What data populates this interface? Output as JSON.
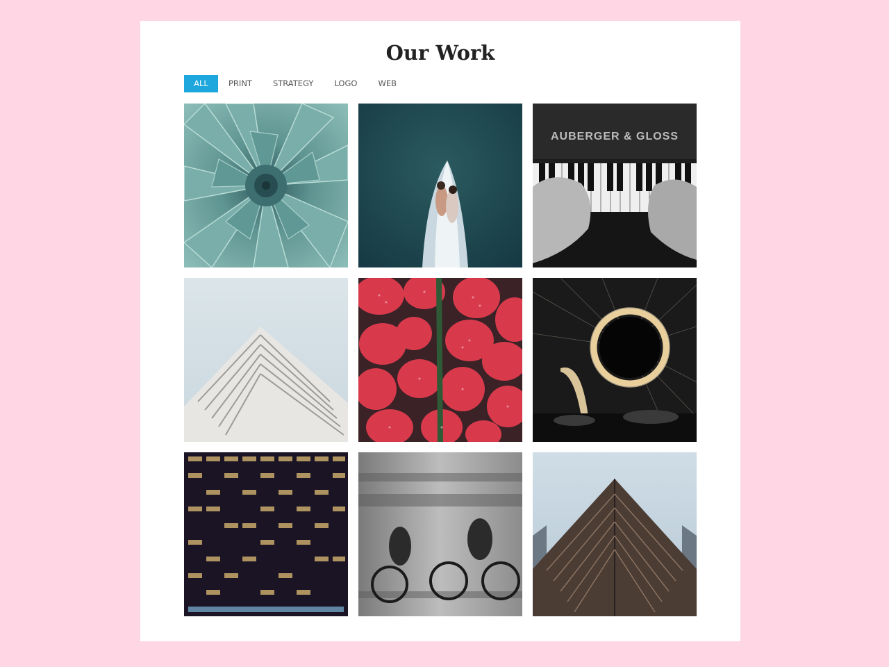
{
  "header": {
    "title": "Our Work"
  },
  "filters": [
    {
      "label": "All",
      "active": true
    },
    {
      "label": "Print",
      "active": false
    },
    {
      "label": "Strategy",
      "active": false
    },
    {
      "label": "Logo",
      "active": false
    },
    {
      "label": "Web",
      "active": false
    }
  ],
  "gallery": {
    "items": [
      {
        "icon": "succulent-photo"
      },
      {
        "icon": "boat-couple-photo"
      },
      {
        "icon": "piano-hands-photo",
        "overlay_text": "AUBERGER & GLOSS"
      },
      {
        "icon": "white-building-photo"
      },
      {
        "icon": "strawberries-photo"
      },
      {
        "icon": "steel-wool-fire-circle-photo"
      },
      {
        "icon": "night-office-building-photo"
      },
      {
        "icon": "cyclists-motion-photo"
      },
      {
        "icon": "brown-building-photo"
      }
    ]
  },
  "colors": {
    "page_background": "#ffd6e3",
    "card_background": "#ffffff",
    "accent": "#1ea7dc"
  }
}
